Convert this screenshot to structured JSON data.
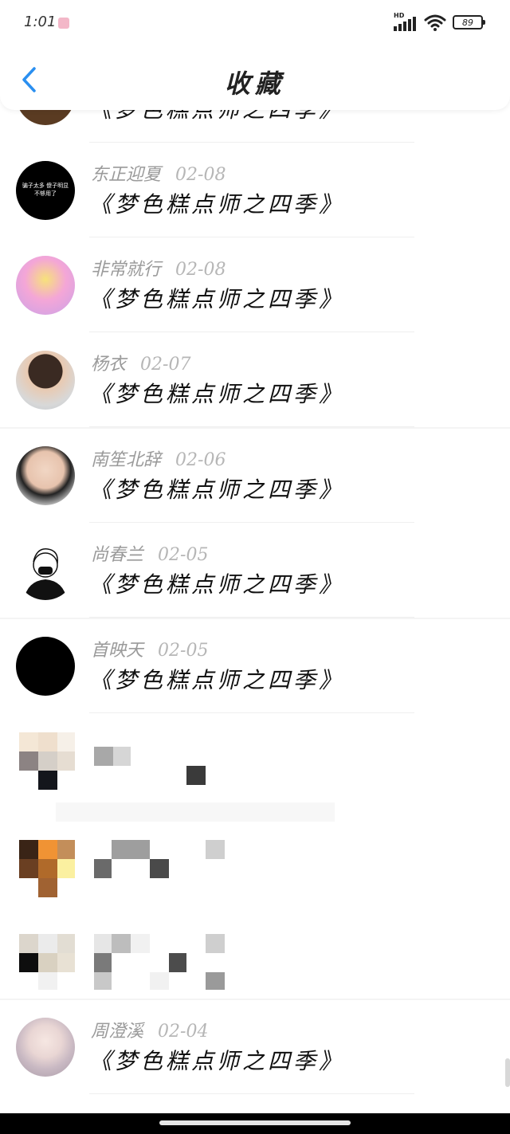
{
  "status": {
    "time": "1:01",
    "network": "HD",
    "battery": "89"
  },
  "header": {
    "title": "收藏",
    "back_icon": "chevron-left-icon",
    "accent": "#2a8ff0"
  },
  "items": [
    {
      "user": "",
      "date": "",
      "title": "《梦色糕点师之四季》"
    },
    {
      "user": "东正迎夏",
      "date": "02-08",
      "title": "《梦色糕点师之四季》",
      "avatar_text": "骗子太多 傻子明显不够用了"
    },
    {
      "user": "非常就行",
      "date": "02-08",
      "title": "《梦色糕点师之四季》"
    },
    {
      "user": "杨衣",
      "date": "02-07",
      "title": "《梦色糕点师之四季》"
    },
    {
      "user": "南笙北辞",
      "date": "02-06",
      "title": "《梦色糕点师之四季》"
    },
    {
      "user": "尚春兰",
      "date": "02-05",
      "title": "《梦色糕点师之四季》"
    },
    {
      "user": "首映天",
      "date": "02-05",
      "title": "《梦色糕点师之四季》"
    },
    {
      "user": "周澄溪",
      "date": "02-04",
      "title": "《梦色糕点师之四季》"
    }
  ]
}
